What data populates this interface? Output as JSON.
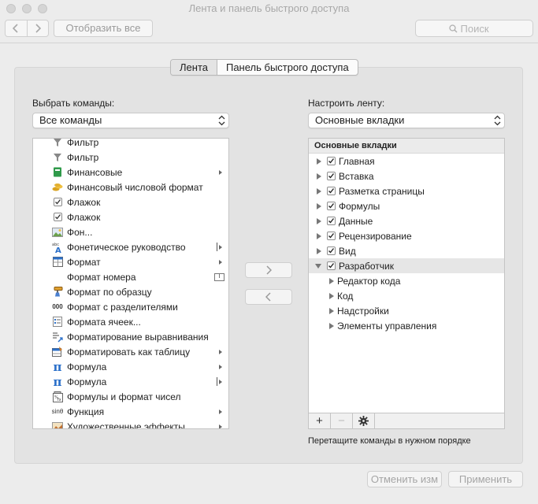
{
  "window": {
    "title": "Лента и панель быстрого доступа"
  },
  "toolbar": {
    "show_all": "Отобразить все",
    "search_placeholder": "Поиск"
  },
  "segment": {
    "tab1": "Лента",
    "tab2": "Панель быстрого доступа"
  },
  "left": {
    "label": "Выбрать команды:",
    "dropdown": "Все команды",
    "items": [
      {
        "label": "Фильтр",
        "icon": "filter-icon"
      },
      {
        "label": "Фильтр",
        "icon": "filter-icon"
      },
      {
        "label": "Финансовые",
        "icon": "finance-book-icon",
        "sub": true
      },
      {
        "label": "Финансовый числовой формат",
        "icon": "coins-icon"
      },
      {
        "label": "Флажок",
        "icon": "checkbox-icon"
      },
      {
        "label": "Флажок",
        "icon": "checkbox-icon"
      },
      {
        "label": "Фон...",
        "icon": "background-image-icon"
      },
      {
        "label": "Фонетическое руководство",
        "icon": "phonetic-guide-icon",
        "pipe": true,
        "sub": true
      },
      {
        "label": "Формат",
        "icon": "format-icon",
        "sub": true
      },
      {
        "label": "Формат номера",
        "icon": "",
        "textind": "I"
      },
      {
        "label": "Формат по образцу",
        "icon": "format-painter-icon"
      },
      {
        "label": "Формат с разделителями",
        "icon": "thousands-separator-icon"
      },
      {
        "label": "Формата ячеек...",
        "icon": "format-cells-icon"
      },
      {
        "label": "Форматирование выравнивания",
        "icon": "alignment-icon"
      },
      {
        "label": "Форматировать как таблицу",
        "icon": "format-table-icon",
        "sub": true
      },
      {
        "label": "Формула",
        "icon": "pi-icon",
        "sub": true
      },
      {
        "label": "Формула",
        "icon": "pi-icon",
        "pipe": true,
        "sub": true
      },
      {
        "label": "Формулы и формат чисел",
        "icon": "formula-number-icon"
      },
      {
        "label": "Функция",
        "icon": "function-icon",
        "sub": true
      },
      {
        "label": "Художественные эффекты",
        "icon": "art-effects-icon",
        "sub": true
      }
    ],
    "icon_glyphs": {
      "thousands": "000",
      "function": "sinθ",
      "pi": "π",
      "abc": "abc"
    }
  },
  "right": {
    "label": "Настроить ленту:",
    "dropdown": "Основные вкладки",
    "header": "Основные вкладки",
    "tabs": [
      {
        "label": "Главная",
        "checked": true
      },
      {
        "label": "Вставка",
        "checked": true
      },
      {
        "label": "Разметка страницы",
        "checked": true
      },
      {
        "label": "Формулы",
        "checked": true
      },
      {
        "label": "Данные",
        "checked": true
      },
      {
        "label": "Рецензирование",
        "checked": true
      },
      {
        "label": "Вид",
        "checked": true
      },
      {
        "label": "Разработчик",
        "checked": true,
        "expanded": true
      }
    ],
    "children": [
      "Редактор кода",
      "Код",
      "Надстройки",
      "Элементы управления"
    ],
    "hint": "Перетащите команды в нужном порядке",
    "add": "+",
    "remove": "−"
  },
  "buttons": {
    "cancel": "Отменить изм",
    "apply": "Применить"
  }
}
